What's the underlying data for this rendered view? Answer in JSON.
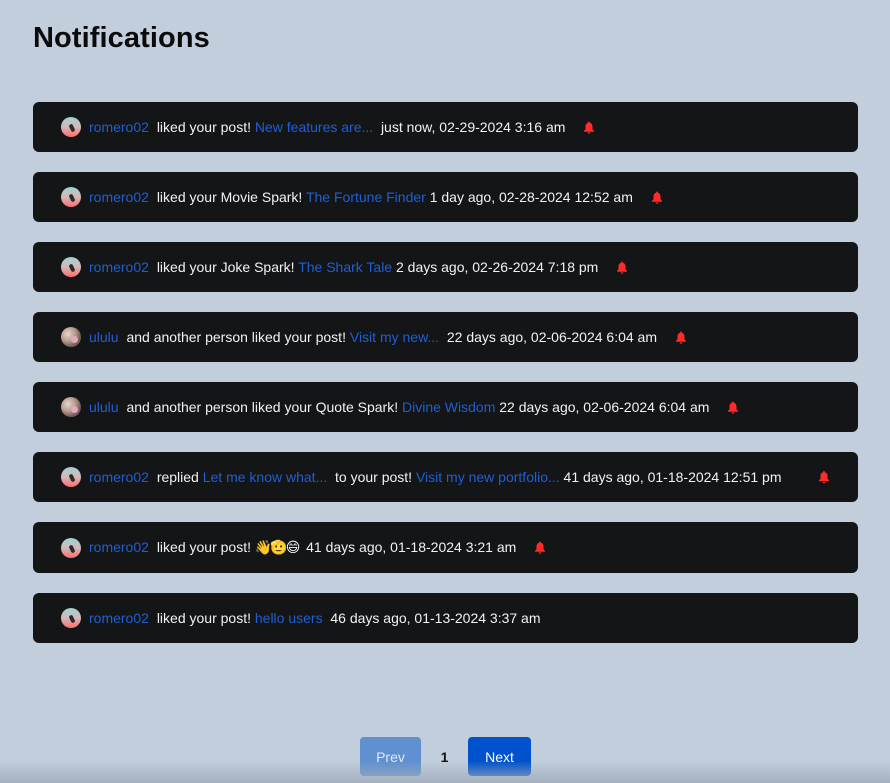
{
  "page": {
    "title": "Notifications"
  },
  "colors": {
    "background": "#c3cedd",
    "card": "#141517",
    "link": "#1f5fd4",
    "bell": "#ff2a2a",
    "next_button": "#0052cc",
    "prev_button": "#6090d0"
  },
  "notifications": [
    {
      "avatar": "romero02-avatar",
      "user": "romero02",
      "action": "liked your post!",
      "target": "New features are...",
      "time": "just now, 02-29-2024 3:16 am",
      "bell": true
    },
    {
      "avatar": "romero02-avatar",
      "user": "romero02",
      "action": "liked your Movie Spark!",
      "target": "The Fortune Finder",
      "time": "1 day ago, 02-28-2024 12:52 am",
      "bell": true
    },
    {
      "avatar": "romero02-avatar",
      "user": "romero02",
      "action": "liked your Joke Spark!",
      "target": "The Shark Tale",
      "time": "2 days ago, 02-26-2024 7:18 pm",
      "bell": true
    },
    {
      "avatar": "ululu-avatar",
      "user": "ululu",
      "action": "and another person liked your post!",
      "target": "Visit my new...",
      "time": "22 days ago, 02-06-2024 6:04 am",
      "bell": true
    },
    {
      "avatar": "ululu-avatar",
      "user": "ululu",
      "action": "and another person liked your Quote Spark!",
      "target": "Divine Wisdom",
      "time": "22 days ago, 02-06-2024 6:04 am",
      "bell": true
    },
    {
      "avatar": "romero02-avatar",
      "user": "romero02",
      "action": "replied",
      "reply": "Let me know what...",
      "action2": "to your post!",
      "target": "Visit my new portfolio...",
      "time": "41 days ago, 01-18-2024 12:51 pm",
      "bell": true
    },
    {
      "avatar": "romero02-avatar",
      "user": "romero02",
      "action": "liked your post!",
      "target": "👋🫡😄",
      "time": "41 days ago, 01-18-2024 3:21 am",
      "bell": true
    },
    {
      "avatar": "romero02-avatar",
      "user": "romero02",
      "action": "liked your post!",
      "target": "hello users",
      "time": "46 days ago, 01-13-2024 3:37 am",
      "bell": false
    }
  ],
  "pagination": {
    "prev_label": "Prev",
    "current_page": "1",
    "next_label": "Next"
  }
}
